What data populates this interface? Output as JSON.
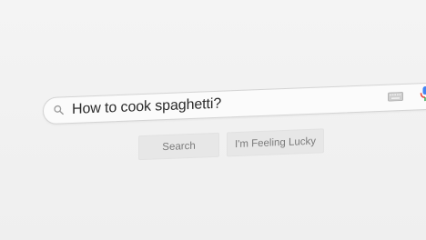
{
  "search": {
    "query": "How to cook spaghetti?",
    "icons": {
      "search": "search-icon",
      "keyboard": "keyboard-icon",
      "voice": "microphone-icon"
    }
  },
  "buttons": {
    "search_label": "Search",
    "lucky_label": "I'm Feeling Lucky"
  },
  "colors": {
    "background": "#f2f2f2",
    "box_border": "#d4d4d4",
    "button_bg": "#e7e7e7",
    "button_text": "#7b7b7b",
    "query_text": "#2a2a2a"
  }
}
